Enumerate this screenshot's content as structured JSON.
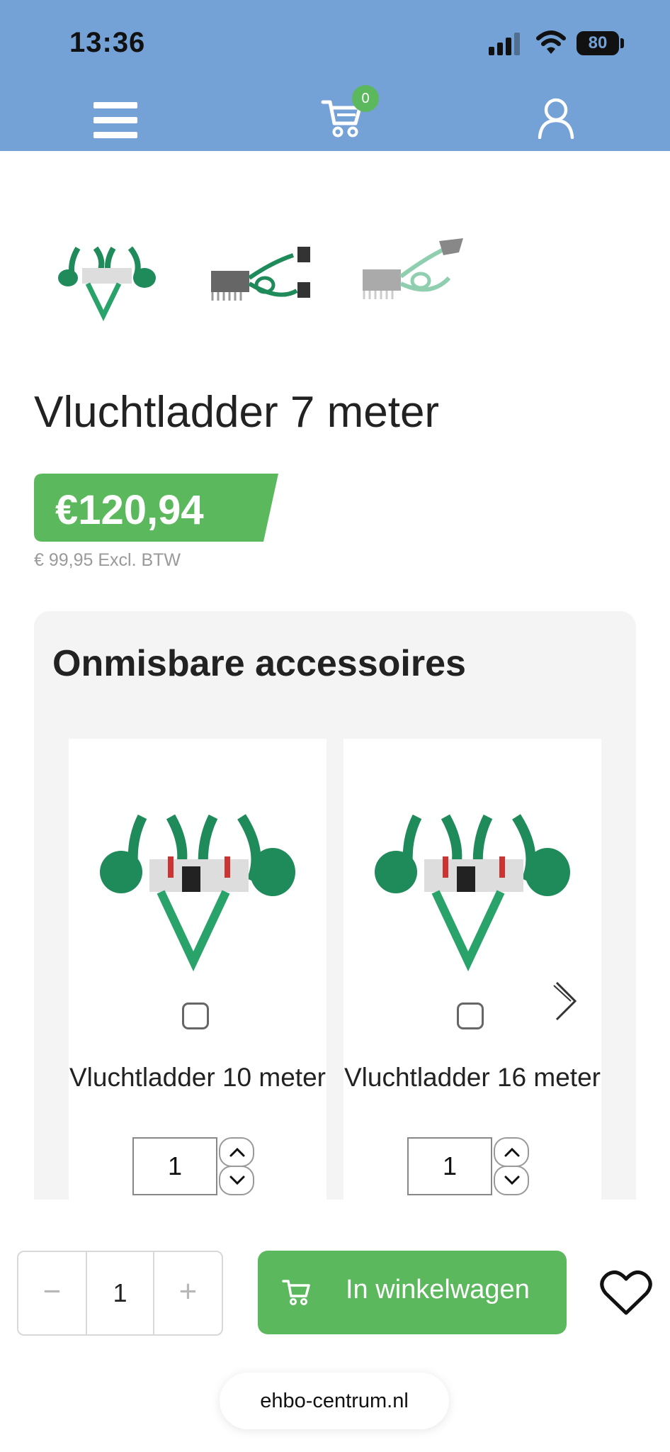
{
  "status_bar": {
    "time": "13:36",
    "battery": "80"
  },
  "header": {
    "cart_count": "0"
  },
  "product": {
    "title": "Vluchtladder 7 meter",
    "price": "€120,94",
    "price_excl": "€ 99,95 Excl. BTW"
  },
  "accessories": {
    "title": "Onmisbare accessoires",
    "items": [
      {
        "name": "Vluchtladder 10 meter",
        "qty": "1"
      },
      {
        "name": "Vluchtladder 16 meter",
        "qty": "1"
      }
    ]
  },
  "bottom_bar": {
    "quantity": "1",
    "minus": "−",
    "plus": "+",
    "add_to_cart_label": "In winkelwagen"
  },
  "browser": {
    "url": "ehbo-centrum.nl"
  },
  "colors": {
    "header": "#74a1d6",
    "accent_green": "#5cb85c"
  },
  "icons": [
    "menu-icon",
    "cart-icon",
    "user-icon",
    "chevron-up-icon",
    "chevron-down-icon",
    "chevron-right-icon",
    "heart-icon"
  ]
}
